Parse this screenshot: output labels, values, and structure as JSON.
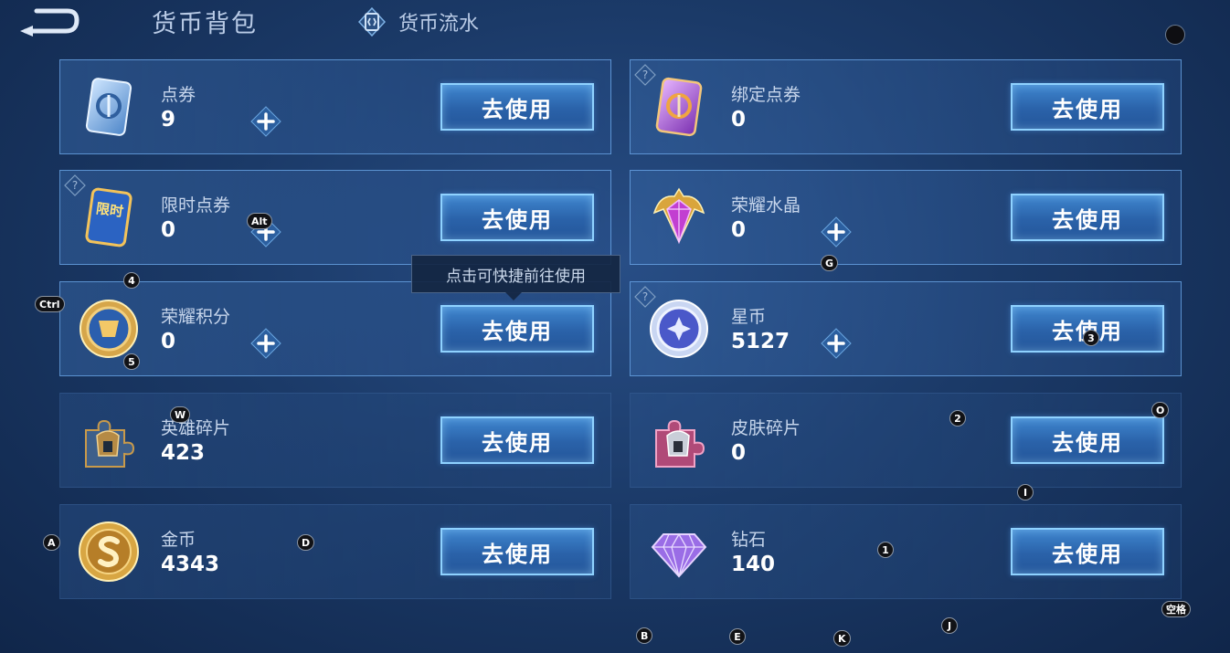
{
  "header": {
    "title": "货币背包",
    "flow_tab_label": "货币流水"
  },
  "tooltip": "点击可快捷前往使用",
  "use_button_label": "去使用",
  "currencies": [
    {
      "name": "点券",
      "value": "9",
      "icon": "coupon-card-icon",
      "has_plus": true,
      "has_help": false
    },
    {
      "name": "绑定点券",
      "value": "0",
      "icon": "bound-coupon-card-icon",
      "has_plus": false,
      "has_help": true
    },
    {
      "name": "限时点券",
      "value": "0",
      "icon": "limited-coupon-card-icon",
      "has_plus": true,
      "has_help": true
    },
    {
      "name": "荣耀水晶",
      "value": "0",
      "icon": "glory-crystal-icon",
      "has_plus": true,
      "has_help": false
    },
    {
      "name": "荣耀积分",
      "value": "0",
      "icon": "glory-points-coin-icon",
      "has_plus": true,
      "has_help": false
    },
    {
      "name": "星币",
      "value": "5127",
      "icon": "star-coin-icon",
      "has_plus": true,
      "has_help": true
    },
    {
      "name": "英雄碎片",
      "value": "423",
      "icon": "hero-fragment-icon",
      "has_plus": false,
      "has_help": false
    },
    {
      "name": "皮肤碎片",
      "value": "0",
      "icon": "skin-fragment-icon",
      "has_plus": false,
      "has_help": false
    },
    {
      "name": "金币",
      "value": "4343",
      "icon": "gold-coin-icon",
      "has_plus": false,
      "has_help": false
    },
    {
      "name": "钻石",
      "value": "140",
      "icon": "diamond-icon",
      "has_plus": false,
      "has_help": false
    }
  ],
  "icon_text": {
    "limited": "限时"
  },
  "shortcut_hints": [
    "Alt",
    "4",
    "Ctrl",
    "5",
    "G",
    "3",
    "W",
    "2",
    "O",
    "I",
    "A",
    "D",
    "1",
    "B",
    "E",
    "K",
    "J",
    "空格"
  ],
  "colors": {
    "accent": "#8fd2ff",
    "button": "#2a62a9",
    "background": "#1b3a68"
  }
}
